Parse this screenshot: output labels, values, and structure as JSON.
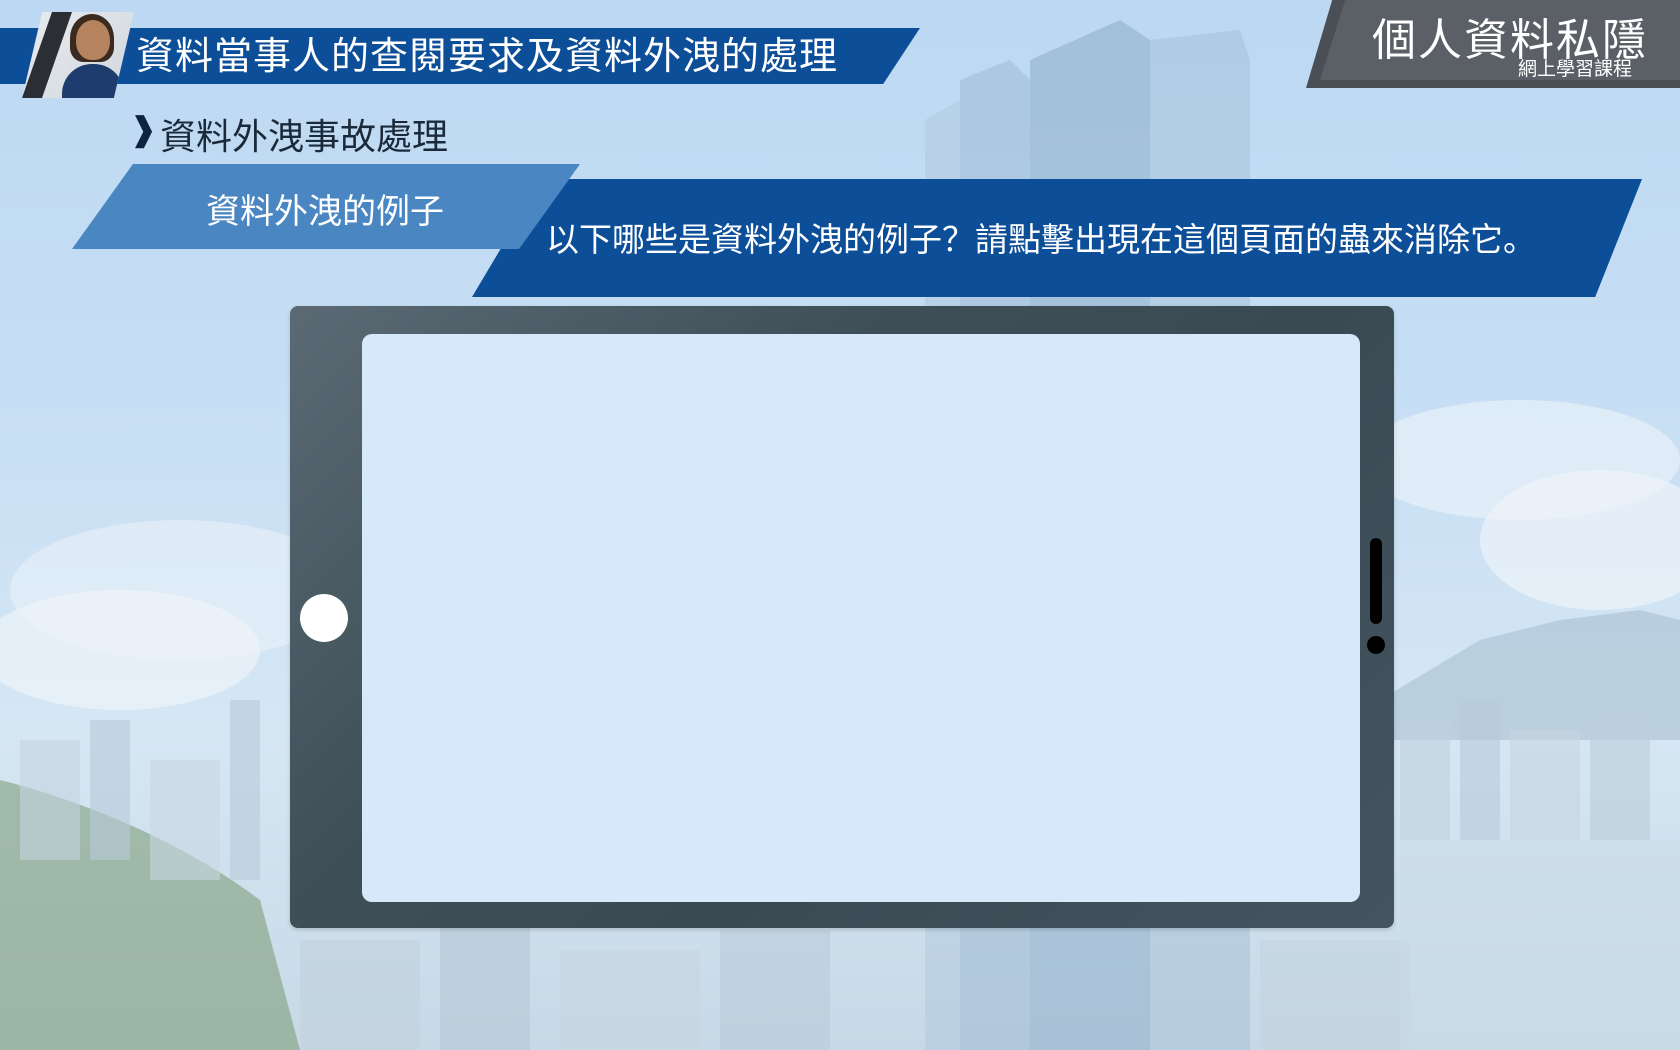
{
  "header": {
    "title": "資料當事人的查閱要求及資料外洩的處理"
  },
  "brand": {
    "title": "個人資料私隱",
    "subtitle": "網上學習課程"
  },
  "section": {
    "chevron": "❱",
    "title": "資料外洩事故處理"
  },
  "subtopic": {
    "label": "資料外洩的例子"
  },
  "question": {
    "text": "以下哪些是資料外洩的例子？請點擊出現在這個頁面的蟲來消除它。"
  },
  "colors": {
    "primary_blue": "#0d4e99",
    "secondary_blue": "#4a86c2",
    "brand_gray": "#5b6067",
    "tablet_frame": "#3e4f58",
    "tablet_screen": "#d6e9fa"
  },
  "icons": {
    "section_marker": "chevron-right-icon",
    "tablet_home": "home-button-icon"
  }
}
